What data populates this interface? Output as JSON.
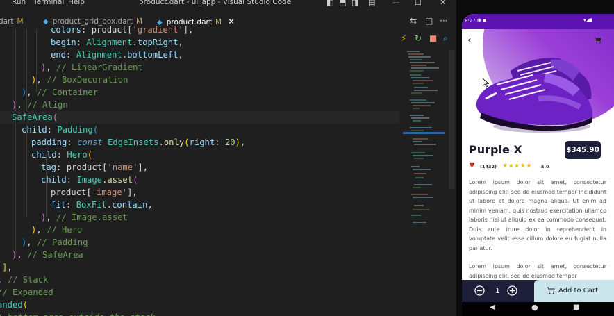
{
  "titlebar": {
    "menu": [
      "Run",
      "Terminal",
      "Help"
    ],
    "window_title": "product.dart - ui_app - Visual Studio Code"
  },
  "tabs": [
    {
      "label": "dart",
      "modified": "M",
      "active": false
    },
    {
      "label": "product_grid_box.dart",
      "modified": "M",
      "active": false
    },
    {
      "label": "product.dart",
      "modified": "M",
      "active": true
    }
  ],
  "code_lines": [
    "          colors: product['gradient'],",
    "          begin: Alignment.topRight,",
    "          end: Alignment.bottomLeft,",
    "        ), // LinearGradient",
    "      ), // BoxDecoration",
    "    ), // Container",
    "  ), // Align",
    "  SafeArea(",
    "    child: Padding(",
    "      padding: const EdgeInsets.only(right: 20),",
    "      child: Hero(",
    "        tag: product['name'],",
    "        child: Image.asset(",
    "          product['image'],",
    "          fit: BoxFit.contain,",
    "        ), // Image.asset",
    "      ), // Hero",
    "    ), // Padding",
    "  ), // SafeArea",
    "],",
    "), // Stack",
    "// Expanded",
    "Expanded(",
    "// bottom area outside the stack"
  ],
  "phone": {
    "status_time": "8:27",
    "title": "Purple X",
    "price": "$345.90",
    "reviews": "(1432)",
    "rating_value": "5.0",
    "rating_stars": 5,
    "description_1": "Lorem ipsum dolor sit amet, consectetur adipiscing elit, sed do eiusmod tempor incididunt ut labore et dolore magna aliqua. Ut enim ad minim veniam, quis nostrud exercitation ullamco laboris nisi ut aliquip ex ea commodo consequat. Duis aute irure dolor in reprehenderit in voluptate velit esse cillum dolore eu fugiat nulla pariatur.",
    "description_2": "Lorem ipsum dolor sit amet, consectetur adipiscing elit, sed do eiusmod tempor",
    "quantity": "1",
    "add_to_cart": "Add to Cart"
  },
  "colors": {
    "editor_bg": "#1f1f1f",
    "accent_purple": "#6a1bbf",
    "dark_navy": "#1d2038",
    "cart_button": "#cbe6ea",
    "heart_red": "#c0392b",
    "star_yellow": "#f5b400"
  },
  "icons": {
    "back": "arrow-back-icon",
    "cart": "shopping-cart-icon",
    "heart": "heart-icon",
    "minus": "minus-circle-icon",
    "plus": "plus-circle-icon"
  }
}
